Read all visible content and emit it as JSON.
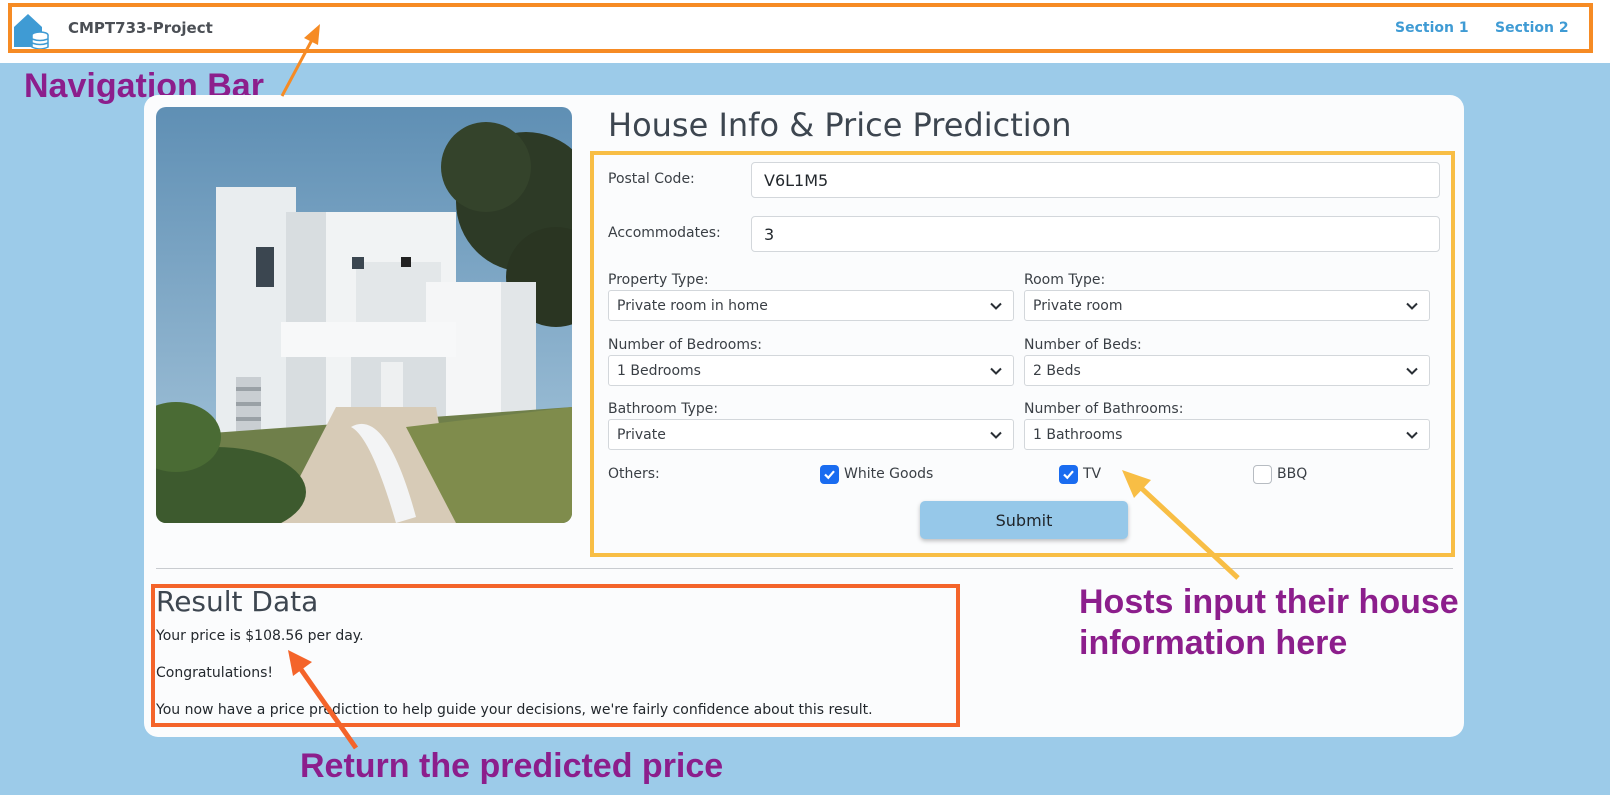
{
  "navbar": {
    "brand": "CMPT733-Project",
    "links": [
      {
        "label": "Section 1"
      },
      {
        "label": "Section 2"
      }
    ]
  },
  "annotations": {
    "navbar_label": "Navigation Bar",
    "form_label_line1": "Hosts input their house",
    "form_label_line2": "information here",
    "result_label": "Return the predicted price",
    "colors": {
      "text": "#8c1e8c",
      "nav_box": "#f68b24",
      "form_box": "#f8be45",
      "result_box": "#f4642a"
    }
  },
  "form": {
    "title": "House Info & Price Prediction",
    "postal_code": {
      "label": "Postal Code:",
      "value": "V6L1M5"
    },
    "accommodates": {
      "label": "Accommodates:",
      "value": "3"
    },
    "property_type": {
      "label": "Property Type:",
      "selected": "Private room in home"
    },
    "room_type": {
      "label": "Room Type:",
      "selected": "Private room"
    },
    "bedrooms": {
      "label": "Number of Bedrooms:",
      "selected": "1 Bedrooms"
    },
    "beds": {
      "label": "Number of Beds:",
      "selected": "2 Beds"
    },
    "bathroom_type": {
      "label": "Bathroom Type:",
      "selected": "Private"
    },
    "bathrooms": {
      "label": "Number of Bathrooms:",
      "selected": "1 Bathrooms"
    },
    "others": {
      "label": "Others:",
      "options": [
        {
          "label": "White Goods",
          "checked": true
        },
        {
          "label": "TV",
          "checked": true
        },
        {
          "label": "BBQ",
          "checked": false
        }
      ]
    },
    "submit_label": "Submit"
  },
  "result": {
    "title": "Result Data",
    "price_line": "Your price is $108.56 per day.",
    "congrats": "Congratulations!",
    "note": "You now have a price prediction to help guide your decisions, we're fairly confidence about this result."
  }
}
